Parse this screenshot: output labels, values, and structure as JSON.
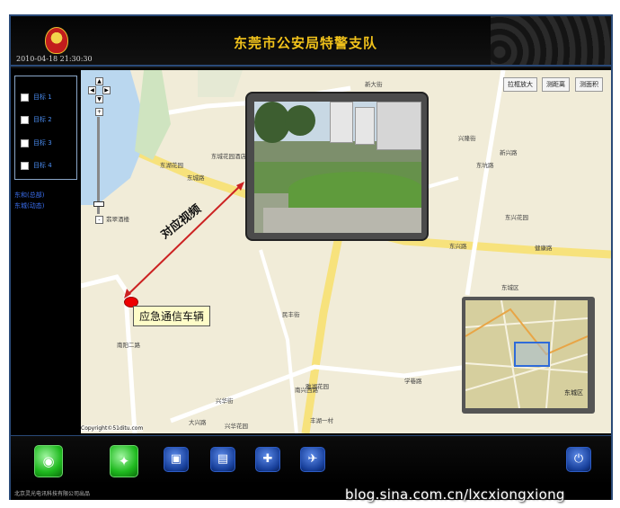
{
  "header": {
    "title": "东莞市公安局特警支队",
    "datetime": "2010-04-18 21:30:30"
  },
  "sidebar": {
    "targets": [
      "目标 1",
      "目标 2",
      "目标 3",
      "目标 4"
    ],
    "notes": [
      "东和(总部)",
      "东城(动态)"
    ]
  },
  "map": {
    "buttons": [
      "拉框放大",
      "测距离",
      "测面积"
    ],
    "vehicle_label": "应急通信车辆",
    "video_label": "对应视频",
    "copyright": "Copyright©51ditu.com",
    "streets": [
      "东城路",
      "东城花园酒店",
      "东湖花园",
      "新兴路",
      "健康路",
      "翡翠酒楼",
      "东兴花园",
      "南阳二路",
      "兴隆街",
      "南兴西路",
      "学巷路",
      "新大街",
      "兴华街",
      "民丰街",
      "雅湖花园",
      "东城区",
      "兴华花园",
      "大兴路",
      "东坑路",
      "东兴路",
      "丰湖一村"
    ]
  },
  "minimap": {
    "district": "东城区"
  },
  "toolbar": {
    "buttons": [
      "target-locate",
      "map-overview",
      "video-window",
      "video-split",
      "pan-map",
      "tile-map",
      "power"
    ]
  },
  "footer": {
    "company": "北京灵光电讯科技有限公司出品"
  },
  "watermark": "blog.sina.com.cn/lxcxiongxiong"
}
